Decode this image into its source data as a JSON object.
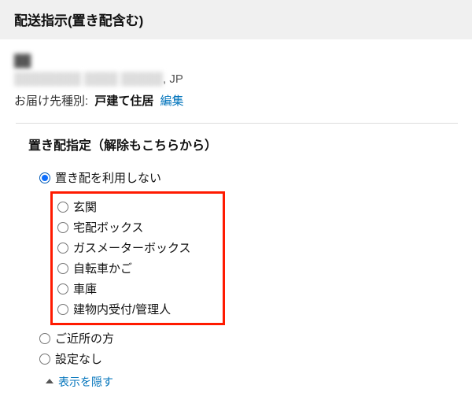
{
  "header": {
    "title": "配送指示(置き配含む)"
  },
  "address": {
    "redacted_name": "██",
    "redacted_line": "████████ ████ █████",
    "suffix": ", JP",
    "type_label": "お届け先種別:",
    "type_value": "戸建て住居",
    "edit_link": "編集"
  },
  "section": {
    "title": "置き配指定（解除もこちらから）",
    "selected_index": 0,
    "options_top": [
      "置き配を利用しない"
    ],
    "options_boxed": [
      "玄関",
      "宅配ボックス",
      "ガスメーターボックス",
      "自転車かご",
      "車庫",
      "建物内受付/管理人"
    ],
    "options_bottom": [
      "ご近所の方",
      "設定なし"
    ],
    "collapse_label": "表示を隠す"
  },
  "colors": {
    "link": "#0073bb",
    "highlight_border": "#ff1a00",
    "radio_selected": "#0d6efd"
  }
}
